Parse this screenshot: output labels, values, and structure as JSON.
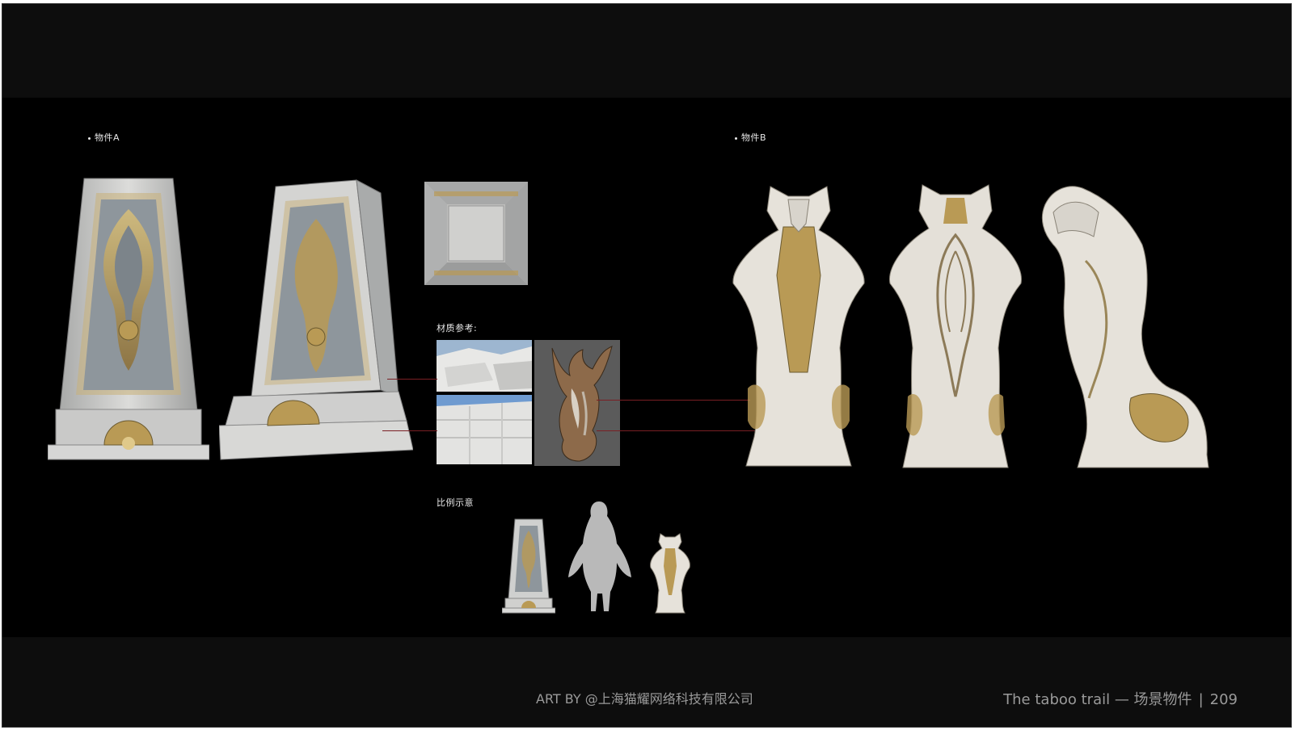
{
  "slide": {
    "label_a": "物件A",
    "label_b": "物件B",
    "material_label": "材质参考:",
    "scale_label": "比例示意",
    "credit": "ART BY @上海猫耀网络科技有限公司",
    "footer": {
      "title": "The taboo trail — 场景物件",
      "separator": "|",
      "page_number": "209"
    }
  },
  "colors": {
    "background": "#000000",
    "stone": "#cfd0cf",
    "gold": "#b99a55",
    "connector": "#7a1f24"
  }
}
